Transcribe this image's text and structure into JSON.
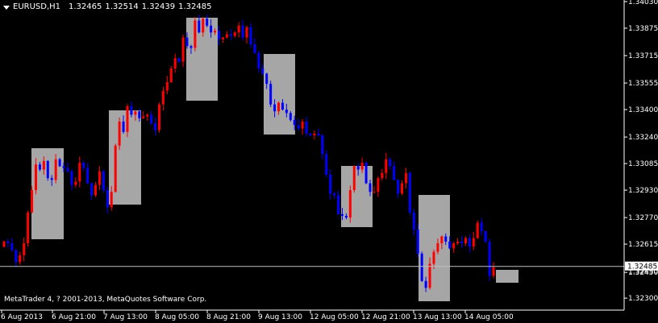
{
  "header": {
    "symbol_tf": "EURUSD,H1",
    "open": "1.32465",
    "high": "1.32514",
    "low": "1.32439",
    "close": "1.32485"
  },
  "footer": {
    "copyright": "MetaTrader 4, ? 2001-2013, MetaQuotes Software Corp."
  },
  "current_price_label": "1.32485",
  "hidden_label_fragment": "1.32450",
  "colors": {
    "background": "#000000",
    "bull": "#ff0000",
    "bear": "#0000ff",
    "axis": "#ffffff",
    "box": "#a6a6a6",
    "price_line": "#c0c0c0"
  },
  "chart_data": {
    "type": "candlestick",
    "symbol": "EURUSD",
    "timeframe": "H1",
    "ylim": [
      1.3223,
      1.3403
    ],
    "y_ticks": [
      "1.34030",
      "1.33875",
      "1.33715",
      "1.33555",
      "1.33400",
      "1.33240",
      "1.33085",
      "1.32930",
      "1.32770",
      "1.32615",
      "1.32450",
      "1.32300"
    ],
    "x_ticks": [
      "6 Aug 2013",
      "6 Aug 21:00",
      "7 Aug 13:00",
      "8 Aug 05:00",
      "8 Aug 21:00",
      "9 Aug 13:00",
      "12 Aug 05:00",
      "12 Aug 21:00",
      "13 Aug 13:00",
      "14 Aug 05:00"
    ],
    "close_series": [
      1.3263,
      1.3262,
      1.3258,
      1.3251,
      1.3255,
      1.3262,
      1.328,
      1.3293,
      1.3308,
      1.3305,
      1.331,
      1.33,
      1.3299,
      1.3311,
      1.3307,
      1.3306,
      1.3304,
      1.3296,
      1.3298,
      1.3309,
      1.3306,
      1.3297,
      1.329,
      1.3296,
      1.3304,
      1.3293,
      1.3283,
      1.3292,
      1.3319,
      1.3333,
      1.3327,
      1.3342,
      1.3337,
      1.3339,
      1.3335,
      1.3336,
      1.3337,
      1.3332,
      1.3328,
      1.3343,
      1.3351,
      1.3356,
      1.3364,
      1.337,
      1.3368,
      1.3382,
      1.3377,
      1.3376,
      1.3392,
      1.3385,
      1.3393,
      1.3389,
      1.3385,
      1.3386,
      1.3381,
      1.3382,
      1.3384,
      1.3383,
      1.3385,
      1.3389,
      1.3382,
      1.3388,
      1.3378,
      1.3373,
      1.3364,
      1.3361,
      1.3355,
      1.3343,
      1.3339,
      1.3344,
      1.334,
      1.3338,
      1.3334,
      1.3331,
      1.3329,
      1.3333,
      1.3326,
      1.3325,
      1.3326,
      1.3325,
      1.3314,
      1.3302,
      1.3291,
      1.329,
      1.3279,
      1.3278,
      1.3277,
      1.3293,
      1.3307,
      1.3305,
      1.3309,
      1.3297,
      1.3292,
      1.3292,
      1.33,
      1.3303,
      1.3311,
      1.3307,
      1.3299,
      1.3291,
      1.3297,
      1.3303,
      1.328,
      1.327,
      1.3256,
      1.324,
      1.3236,
      1.325,
      1.3257,
      1.3262,
      1.3266,
      1.3263,
      1.3259,
      1.3262,
      1.3263,
      1.3262,
      1.3265,
      1.326,
      1.3265,
      1.3274,
      1.3269,
      1.3263,
      1.3243,
      1.3248
    ]
  }
}
